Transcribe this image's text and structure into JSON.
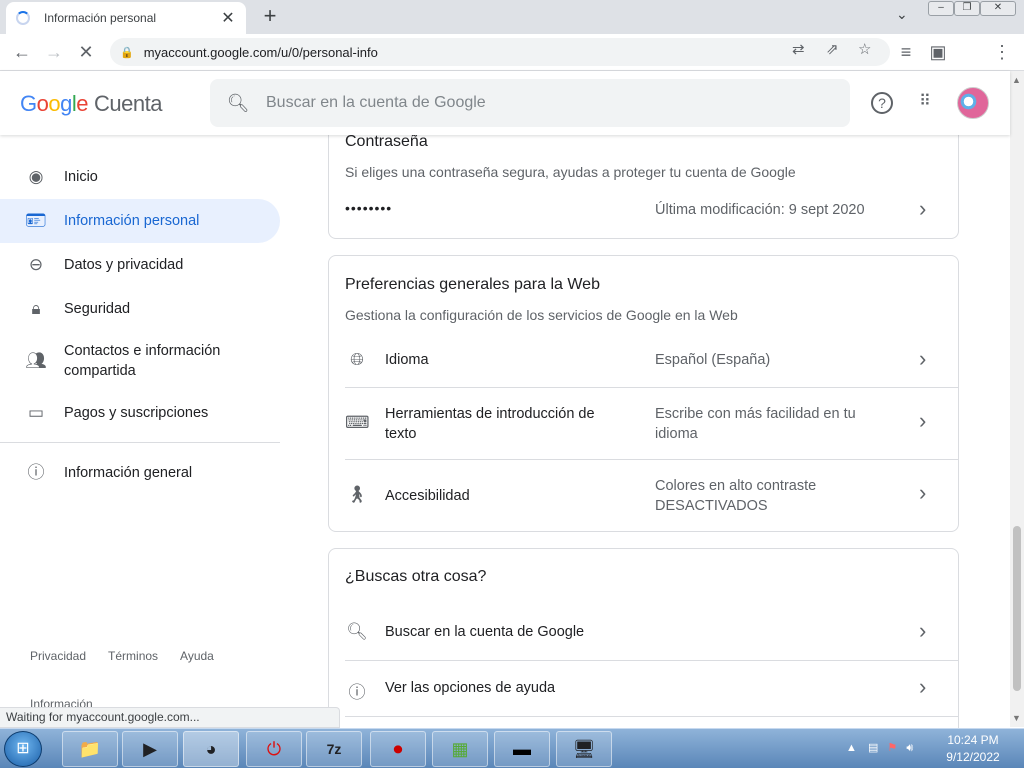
{
  "browser": {
    "tab_title": "Información personal",
    "url": "myaccount.google.com/u/0/personal-info",
    "status_text": "Waiting for myaccount.google.com..."
  },
  "header": {
    "logo_word": "Google",
    "product": "Cuenta",
    "search_placeholder": "Buscar en la cuenta de Google"
  },
  "sidebar": {
    "items": [
      {
        "label": "Inicio",
        "icon": "account-circle-icon"
      },
      {
        "label": "Información personal",
        "icon": "id-card-icon",
        "active": true
      },
      {
        "label": "Datos y privacidad",
        "icon": "toggle-icon"
      },
      {
        "label": "Seguridad",
        "icon": "lock-icon"
      },
      {
        "label": "Contactos e información compartida",
        "icon": "people-icon"
      },
      {
        "label": "Pagos y suscripciones",
        "icon": "credit-card-icon"
      }
    ],
    "general": {
      "label": "Información general",
      "icon": "info-icon"
    },
    "footer_links": [
      "Privacidad",
      "Términos",
      "Ayuda"
    ],
    "footer_more": "Información"
  },
  "password_card": {
    "title": "Contraseña",
    "subtitle": "Si eliges una contraseña segura, ayudas a proteger tu cuenta de Google",
    "masked": "••••••••",
    "last_modified": "Última modificación: 9 sept 2020"
  },
  "prefs_card": {
    "title": "Preferencias generales para la Web",
    "subtitle": "Gestiona la configuración de los servicios de Google en la Web",
    "rows": [
      {
        "label": "Idioma",
        "value": "Español (España)",
        "icon": "globe-icon"
      },
      {
        "label": "Herramientas de introducción de texto",
        "value": "Escribe con más facilidad en tu idioma",
        "icon": "keyboard-icon"
      },
      {
        "label": "Accesibilidad",
        "value": "Colores en alto contraste DESACTIVADOS",
        "icon": "accessibility-icon"
      }
    ]
  },
  "other_card": {
    "title": "¿Buscas otra cosa?",
    "rows": [
      {
        "label": "Buscar en la cuenta de Google",
        "icon": "search-icon"
      },
      {
        "label": "Ver las opciones de ayuda",
        "icon": "help-icon"
      }
    ]
  },
  "taskbar": {
    "time": "10:24 PM",
    "date": "9/12/2022"
  }
}
